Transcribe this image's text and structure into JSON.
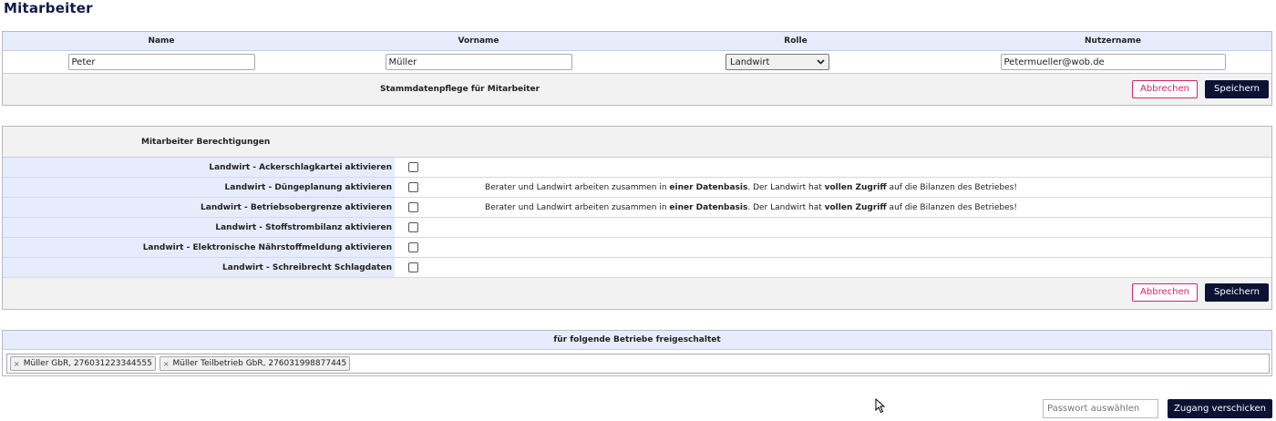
{
  "page": {
    "title": "Mitarbeiter"
  },
  "stammdaten": {
    "columns": [
      "Name",
      "Vorname",
      "Rolle",
      "Nutzername"
    ],
    "name_value": "Peter",
    "vorname_value": "Müller",
    "rolle_value": "Landwirt",
    "nutzername_value": "Petermueller@wob.de",
    "footer_label": "Stammdatenpflege für Mitarbeiter",
    "cancel_label": "Abbrechen",
    "save_label": "Speichern"
  },
  "berechtigungen": {
    "heading": "Mitarbeiter Berechtigungen",
    "rows": [
      {
        "label": "Landwirt - Ackerschlagkartei aktivieren",
        "checked": false
      },
      {
        "label": "Landwirt - Düngeplanung aktivieren",
        "checked": false
      },
      {
        "label": "Landwirt - Betriebsobergrenze aktivieren",
        "checked": false
      },
      {
        "label": "Landwirt - Stoffstrombilanz aktivieren",
        "checked": false
      },
      {
        "label": "Landwirt - Elektronische Nährstoffmeldung aktivieren",
        "checked": false
      },
      {
        "label": "Landwirt - Schreibrecht Schlagdaten",
        "checked": false
      }
    ],
    "note": {
      "part1": "Berater und Landwirt arbeiten zusammen in ",
      "bold1": "einer Datenbasis",
      "part2": ". Der Landwirt hat ",
      "bold2": "vollen Zugriff",
      "part3": " auf die Bilanzen des Betriebes!"
    },
    "cancel_label": "Abbrechen",
    "save_label": "Speichern"
  },
  "betriebe": {
    "heading": "für folgende Betriebe freigeschaltet",
    "tags": [
      {
        "remove": "×",
        "label": "Müller GbR, 276031223344555"
      },
      {
        "remove": "×",
        "label": "Müller Teilbetrieb GbR, 276031998877445"
      }
    ]
  },
  "zugang": {
    "password_placeholder": "Passwort auswählen",
    "send_label": "Zugang verschicken"
  },
  "colors": {
    "header_bg": "#e6ecfb",
    "primary_dark": "#0c1233",
    "cancel_accent": "#d6246e"
  }
}
